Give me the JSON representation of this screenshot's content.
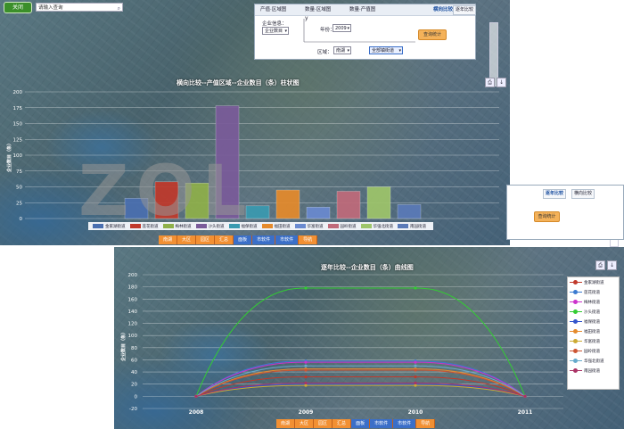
{
  "top": {
    "close_label": "关闭",
    "search_placeholder": "请输入查询",
    "search_icon": "search-icon"
  },
  "query_panel": {
    "tabs": [
      "产值·区域图",
      "数量·区域图",
      "数量·产值图"
    ],
    "right_tabs": [
      "横向比较",
      "逐年比较"
    ],
    "type_label": "企业信息：",
    "type_value": "企业数目",
    "year_label": "年份：",
    "year_value": "2009",
    "region_label": "区域：",
    "region_value": "南湖",
    "query_button": "查询统计",
    "region_picker": "全部镇街道",
    "y_axis_glyph": "y"
  },
  "chart1": {
    "title": "横向比较--产值区域--企业数目（条）柱状图",
    "ylabel": "企业数目（条）",
    "nav": [
      "南湖",
      "大区",
      "园区",
      "汇总",
      "面板",
      "市软件",
      "市软件",
      "导航"
    ],
    "icons": [
      "print-icon",
      "save-icon"
    ]
  },
  "chart2": {
    "title": "逐年比较--企业数目（条）曲线图",
    "ylabel": "企业数目（条）",
    "nav": [
      "南湖",
      "大区",
      "园区",
      "汇总",
      "面板",
      "市软件",
      "市软件",
      "导航"
    ],
    "icons": [
      "print-icon",
      "save-icon"
    ]
  },
  "small_panel": {
    "tabs": [
      "逐年比较",
      "横向比较"
    ],
    "button": "查询统计"
  },
  "watermark": "ZOL",
  "chart_data": [
    {
      "type": "bar",
      "title": "横向比较--产值区域--企业数目（条）柱状图",
      "ylabel": "企业数目（条）",
      "xlabel": "",
      "ylim": [
        0,
        200
      ],
      "yticks": [
        0,
        25,
        50,
        75,
        100,
        125,
        150,
        175,
        200
      ],
      "grid": true,
      "legend_position": "bottom",
      "categories": [
        "金家湖街道",
        "莲花街道",
        "梅林街道",
        "沙头街道",
        "福保街道",
        "福田街道",
        "华富街道",
        "园岭街道",
        "华强北街道",
        "南园街道"
      ],
      "values": [
        32,
        58,
        56,
        178,
        20,
        45,
        18,
        43,
        50,
        22
      ],
      "colors": [
        "#4a6fb0",
        "#c0392b",
        "#8fb04a",
        "#7a5b9a",
        "#3a9ab0",
        "#e58a2b",
        "#6a8ad0",
        "#c06a7a",
        "#9ec56a",
        "#5a7ab8"
      ]
    },
    {
      "type": "line",
      "title": "逐年比较--企业数目（条）曲线图",
      "ylabel": "企业数目（条）",
      "xlabel": "",
      "x": [
        "2008",
        "2009",
        "2010",
        "2011"
      ],
      "ylim": [
        -20,
        200
      ],
      "yticks": [
        -20,
        0,
        20,
        40,
        60,
        80,
        100,
        120,
        140,
        160,
        180,
        200
      ],
      "grid": true,
      "legend_position": "right",
      "series": [
        {
          "name": "金家湖街道",
          "values": [
            0,
            32,
            32,
            0
          ],
          "color": "#c0392b"
        },
        {
          "name": "莲花街道",
          "values": [
            0,
            58,
            58,
            0
          ],
          "color": "#3a7ad0"
        },
        {
          "name": "梅林街道",
          "values": [
            0,
            56,
            56,
            0
          ],
          "color": "#cc33cc"
        },
        {
          "name": "沙头街道",
          "values": [
            0,
            178,
            178,
            0
          ],
          "color": "#33cc33"
        },
        {
          "name": "福保街道",
          "values": [
            0,
            20,
            20,
            0
          ],
          "color": "#3355cc"
        },
        {
          "name": "福田街道",
          "values": [
            0,
            45,
            45,
            0
          ],
          "color": "#e58a2b"
        },
        {
          "name": "华富街道",
          "values": [
            0,
            18,
            18,
            0
          ],
          "color": "#ccaa33"
        },
        {
          "name": "园岭街道",
          "values": [
            0,
            43,
            43,
            0
          ],
          "color": "#cc5533"
        },
        {
          "name": "华强北街道",
          "values": [
            0,
            50,
            50,
            0
          ],
          "color": "#66aacc"
        },
        {
          "name": "南园街道",
          "values": [
            0,
            22,
            22,
            0
          ],
          "color": "#aa3366"
        }
      ]
    }
  ]
}
